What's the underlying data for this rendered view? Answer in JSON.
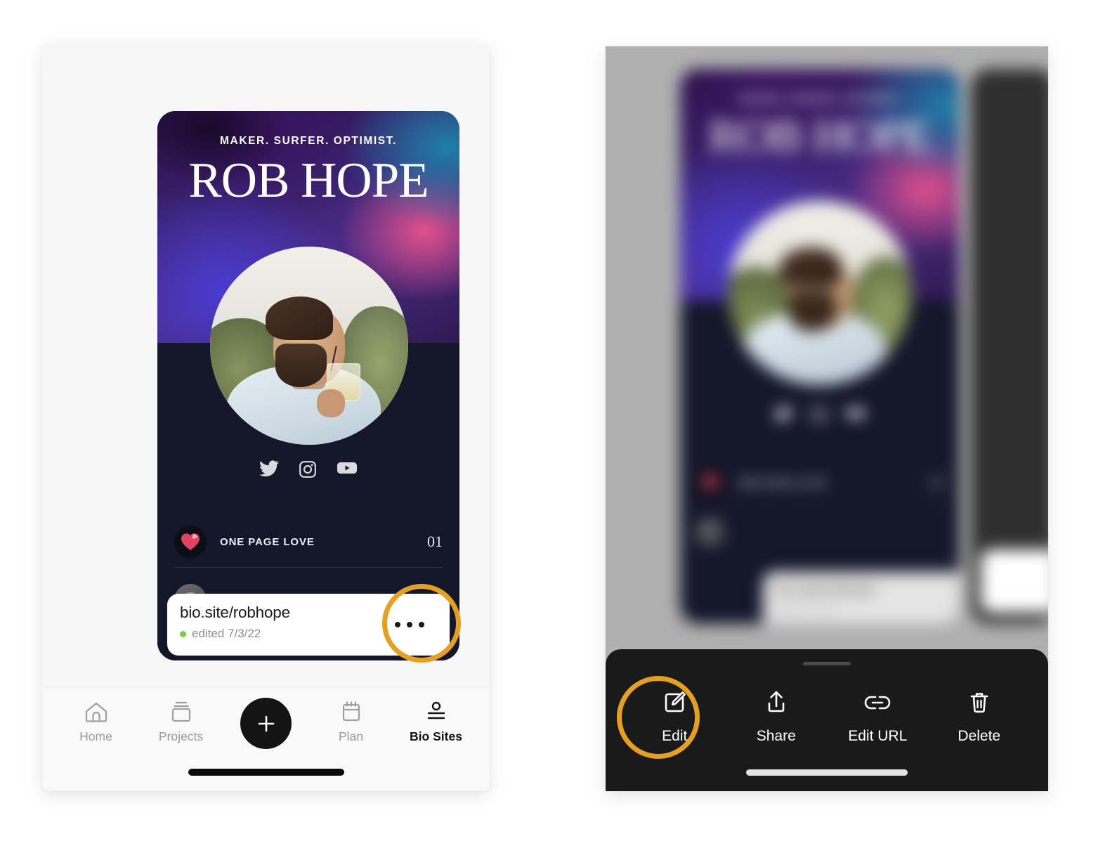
{
  "left_panel": {
    "bio_site": {
      "tagline": "MAKER. SURFER. OPTIMIST.",
      "name": "ROB HOPE",
      "avatar_name": "profile-photo",
      "socials": [
        {
          "name": "twitter-icon"
        },
        {
          "name": "instagram-icon"
        },
        {
          "name": "youtube-icon"
        }
      ],
      "links": [
        {
          "icon": "heart-icon",
          "title": "ONE PAGE LOVE",
          "number": "01"
        }
      ]
    },
    "url_card": {
      "url": "bio.site/robhope",
      "status_dot_color": "#84c84a",
      "edited_label": "edited 7/3/22",
      "kebab_name": "more-options-button"
    },
    "highlight_ring": {
      "color": "#e5a021",
      "target": "more-options-button"
    },
    "tabbar": {
      "items": [
        {
          "label": "Home",
          "icon": "home-icon",
          "active": false
        },
        {
          "label": "Projects",
          "icon": "projects-icon",
          "active": false
        },
        {
          "label": "",
          "icon": "plus-icon",
          "active": false
        },
        {
          "label": "Plan",
          "icon": "calendar-icon",
          "active": false
        },
        {
          "label": "Bio Sites",
          "icon": "bio-sites-icon",
          "active": true
        }
      ]
    }
  },
  "right_panel": {
    "background_color": "#b0b0b0",
    "blurred_bio_site": {
      "tagline": "MAKER. SURFER. OPTIMIST.",
      "name": "ROB HOPE",
      "link_title": "ONE PAGE LOVE",
      "link_number": "01",
      "url": "bio.site/robhope",
      "edited_label": "edited 7/3/22",
      "kebab": "•••"
    },
    "action_sheet": {
      "actions": [
        {
          "label": "Edit",
          "icon": "edit-pencil-icon"
        },
        {
          "label": "Share",
          "icon": "share-upload-icon"
        },
        {
          "label": "Edit URL",
          "icon": "link-chain-icon"
        },
        {
          "label": "Delete",
          "icon": "trash-icon"
        }
      ]
    },
    "highlight_ring": {
      "color": "#e5a021",
      "target": "edit-action"
    }
  }
}
